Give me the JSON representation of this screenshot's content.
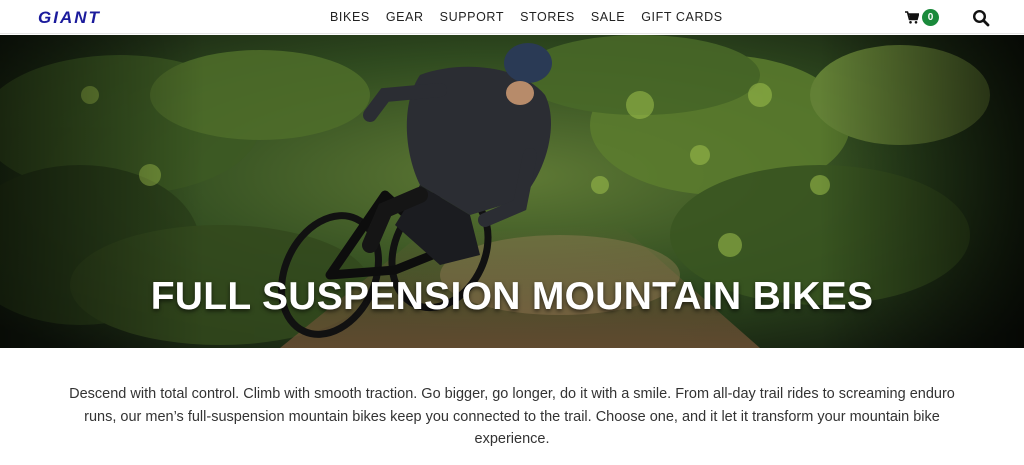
{
  "header": {
    "logo_text": "GIANT",
    "nav": [
      {
        "label": "BIKES"
      },
      {
        "label": "GEAR"
      },
      {
        "label": "SUPPORT"
      },
      {
        "label": "STORES"
      },
      {
        "label": "SALE"
      },
      {
        "label": "GIFT CARDS"
      }
    ],
    "cart_count": "0",
    "icons": {
      "cart": "cart-icon",
      "search": "search-icon"
    },
    "brand_color": "#1b1b9c",
    "cart_badge_color": "#1a8a3b"
  },
  "hero": {
    "title": "FULL SUSPENSION MOUNTAIN BIKES",
    "image": "mountain-biker-on-forest-trail-image"
  },
  "intro": {
    "text": "Descend with total control. Climb with smooth traction. Go bigger, go longer, do it with a smile. From all-day trail rides to screaming enduro runs, our men’s full-suspension mountain bikes keep you connected to the trail. Choose one, and it let it transform your mountain bike experience."
  }
}
